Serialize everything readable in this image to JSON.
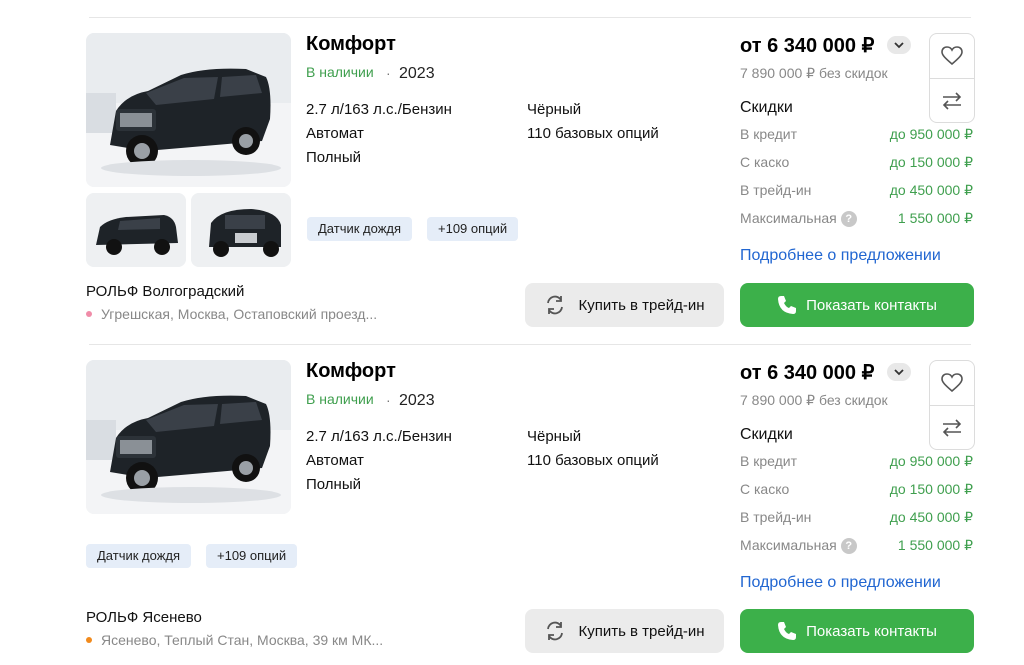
{
  "listings": [
    {
      "title": "Комфорт",
      "availability": "В наличии",
      "dot": "·",
      "year": "2023",
      "engine": "2.7 л/163 л.с./Бензин",
      "transmission": "Автомат",
      "drive": "Полный",
      "color": "Чёрный",
      "options": "110 базовых опций",
      "chips": [
        "Датчик дождя",
        "+109 опций"
      ],
      "price": "от 6 340 000 ₽",
      "old_price": "7 890 000 ₽ без скидок",
      "discounts_title": "Скидки",
      "discounts": [
        {
          "label": "В кредит",
          "value": "до 950 000 ₽"
        },
        {
          "label": "С каско",
          "value": "до 150 000 ₽"
        },
        {
          "label": "В трейд-ин",
          "value": "до 450 000 ₽"
        },
        {
          "label": "Максимальная",
          "value": "1 550 000 ₽"
        }
      ],
      "details_link": "Подробнее о предложении",
      "dealer": "РОЛЬФ Волгоградский",
      "address": "Угрешская, Москва, Остаповский проезд...",
      "metro_color": "#f08ca8",
      "trade_in_label": "Купить в трейд-ин",
      "contacts_label": "Показать контакты",
      "help_glyph": "?"
    },
    {
      "title": "Комфорт",
      "availability": "В наличии",
      "dot": "·",
      "year": "2023",
      "engine": "2.7 л/163 л.с./Бензин",
      "transmission": "Автомат",
      "drive": "Полный",
      "color": "Чёрный",
      "options": "110 базовых опций",
      "chips": [
        "Датчик дождя",
        "+109 опций"
      ],
      "price": "от 6 340 000 ₽",
      "old_price": "7 890 000 ₽ без скидок",
      "discounts_title": "Скидки",
      "discounts": [
        {
          "label": "В кредит",
          "value": "до 950 000 ₽"
        },
        {
          "label": "С каско",
          "value": "до 150 000 ₽"
        },
        {
          "label": "В трейд-ин",
          "value": "до 450 000 ₽"
        },
        {
          "label": "Максимальная",
          "value": "1 550 000 ₽"
        }
      ],
      "details_link": "Подробнее о предложении",
      "dealer": "РОЛЬФ Ясенево",
      "address": "Ясенево, Теплый Стан, Москва, 39 км МК...",
      "metro_color": "#f18a1c",
      "trade_in_label": "Купить в трейд-ин",
      "contacts_label": "Показать контакты",
      "help_glyph": "?"
    }
  ],
  "colors": {
    "accent_green": "#3cb04a",
    "link_blue": "#2166d1",
    "available_green": "#3f9f4e",
    "chip_bg": "#e5edf8"
  },
  "icons": [
    "heart-icon",
    "compare-arrows-icon",
    "chevron-down-icon",
    "refresh-icon",
    "phone-icon",
    "question-icon"
  ]
}
